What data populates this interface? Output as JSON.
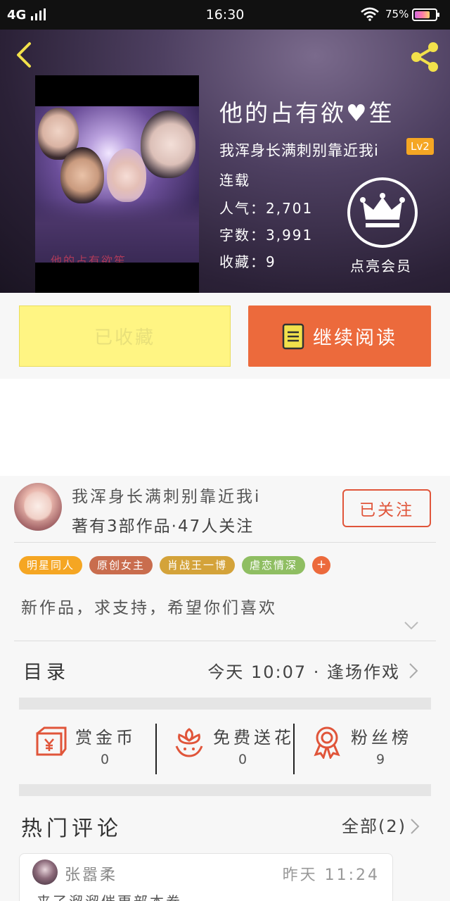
{
  "status_bar": {
    "network": "4G",
    "time": "16:30",
    "battery_text": "75%",
    "battery_level": 0.75
  },
  "book": {
    "title": "他的占有欲♥笙",
    "author": "我浑身长满刺别靠近我i",
    "author_level": "Lv2",
    "status": "连载",
    "popularity": "人气：2,701",
    "word_count": "字数：3,991",
    "favorites": "收藏：9",
    "vip_label": "点亮会员",
    "cover_caption": "他的占有欲笙"
  },
  "actions": {
    "favorited_label": "已收藏",
    "continue_label": "继续阅读"
  },
  "author_card": {
    "name": "我浑身长满刺别靠近我i",
    "stats": "著有3部作品·47人关注",
    "follow_label": "已关注"
  },
  "tags": [
    {
      "label": "明星同人",
      "color": "#f5a623"
    },
    {
      "label": "原创女主",
      "color": "#c96d4e"
    },
    {
      "label": "肖战王一博",
      "color": "#d4a33a"
    },
    {
      "label": "虐恋情深",
      "color": "#8fbe62"
    }
  ],
  "tag_more": "+",
  "intro": "新作品，求支持，希望你们喜欢",
  "toc": {
    "label": "目录",
    "latest": "今天 10:07 · 逢场作戏"
  },
  "stats": [
    {
      "label": "赏金币",
      "value": "0",
      "icon": "gold-coin-envelope-icon"
    },
    {
      "label": "免费送花",
      "value": "0",
      "icon": "flower-icon"
    },
    {
      "label": "粉丝榜",
      "value": "9",
      "icon": "medal-icon"
    }
  ],
  "comments": {
    "title": "热门评论",
    "all_label": "全部(2)",
    "items": [
      {
        "user": "张嚣柔",
        "time": "昨天 11:24",
        "text": "来了溜溜催更部本卷"
      }
    ]
  },
  "colors": {
    "accent_orange": "#ec6a3c",
    "favorited_yellow": "#fff583",
    "follow_red": "#e0553a",
    "lv_badge": "#f5a623",
    "icon_yellow": "#f2e14b",
    "stat_icon_red": "#e0553a"
  }
}
